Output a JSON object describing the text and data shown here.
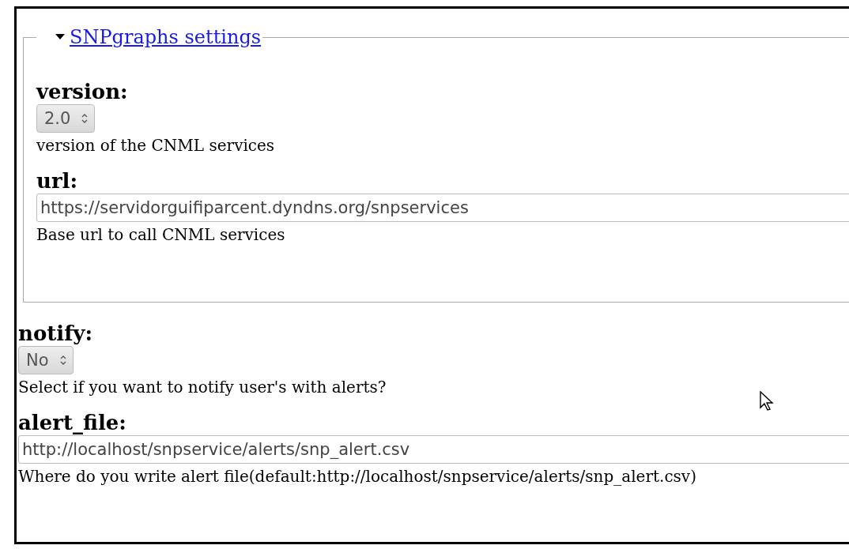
{
  "group": {
    "title": "SNPgraphs settings",
    "expanded": true,
    "fields": [
      {
        "kind": "select",
        "label": "version:",
        "value": "2.0",
        "help": "version of the CNML services"
      },
      {
        "kind": "text",
        "label": "url:",
        "value": "https://servidorguifiparcent.dyndns.org/snpservices",
        "help": "Base url to call CNML services"
      }
    ]
  },
  "fields": [
    {
      "kind": "select",
      "label": "notify:",
      "value": "No",
      "help": "Select if you want to notify user's with alerts?"
    },
    {
      "kind": "text",
      "label": "alert_file:",
      "value": "http://localhost/snpservice/alerts/snp_alert.csv",
      "help": "Where do you write alert file(default:http://localhost/snpservice/alerts/snp_alert.csv)"
    }
  ]
}
